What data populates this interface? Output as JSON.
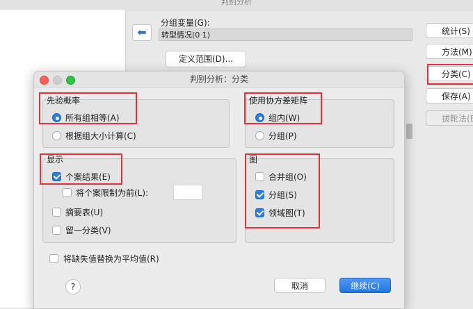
{
  "main_window": {
    "title": "判别分析",
    "group_variable_label": "分组变量(G):",
    "group_variable_value": "转型情况(0 1)",
    "define_range_button": "定义范围(D)...",
    "side_buttons": [
      "统计(S)",
      "方法(M)",
      "分类(C)",
      "保存(A)",
      "拔靴法(B)"
    ]
  },
  "dialog": {
    "title": "判别分析：分类",
    "prior": {
      "legend": "先验概率",
      "options": [
        "所有组相等(A)",
        "根据组大小计算(C)"
      ],
      "selected": 0
    },
    "covariance": {
      "legend": "使用协方差矩阵",
      "options": [
        "组内(W)",
        "分组(P)"
      ],
      "selected": 0
    },
    "display": {
      "legend": "显示",
      "casewise": {
        "label": "个案结果(E)",
        "checked": true
      },
      "limit": {
        "label": "将个案限制为前(L):",
        "checked": false,
        "value": ""
      },
      "summary": {
        "label": "摘要表(U)",
        "checked": false
      },
      "loo": {
        "label": "留一分类(V)",
        "checked": false
      }
    },
    "plots": {
      "legend": "图",
      "combined": {
        "label": "合并组(O)",
        "checked": false
      },
      "separate": {
        "label": "分组(S)",
        "checked": true
      },
      "territorial": {
        "label": "领域图(T)",
        "checked": true
      }
    },
    "replace_missing": {
      "label": "将缺失值替换为平均值(R)",
      "checked": false
    },
    "help_symbol": "?",
    "cancel_button": "取消",
    "continue_button": "继续(C)"
  },
  "colors": {
    "accent": "#2a7de1",
    "highlight": "#e0313a"
  }
}
